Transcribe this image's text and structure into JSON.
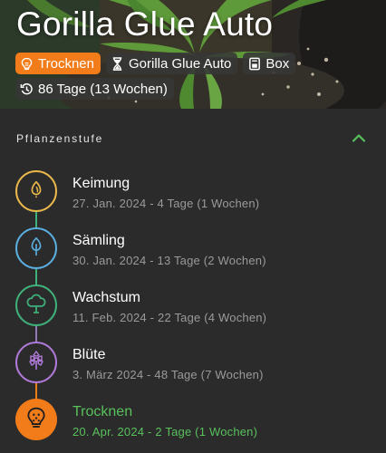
{
  "plant": {
    "title": "Gorilla Glue Auto",
    "chips": [
      {
        "icon": "trocknen-icon",
        "label": "Trocknen",
        "accent": "#f27c1a"
      },
      {
        "icon": "hourglass-icon",
        "label": "Gorilla Glue Auto"
      },
      {
        "icon": "box-icon",
        "label": "Box"
      }
    ],
    "age": {
      "icon": "history-icon",
      "label": "86 Tage (13 Wochen)"
    }
  },
  "panel": {
    "title": "Pflanzenstufe",
    "collapse_icon": "chevron-up-icon",
    "accent": "#58c05c"
  },
  "stages": [
    {
      "name": "Keimung",
      "detail": "27. Jan. 2024 - 4 Tage (1 Wochen)",
      "icon": "seed-icon",
      "color": "#e8b84a"
    },
    {
      "name": "Sämling",
      "detail": "30. Jan. 2024 - 13 Tage (2 Wochen)",
      "icon": "seedling-icon",
      "color": "#5aaee0"
    },
    {
      "name": "Wachstum",
      "detail": "11. Feb. 2024 - 22 Tage (4 Wochen)",
      "icon": "tree-icon",
      "color": "#3fb079"
    },
    {
      "name": "Blüte",
      "detail": "3. März 2024 - 48 Tage (7 Wochen)",
      "icon": "flower-icon",
      "color": "#b07ad8"
    },
    {
      "name": "Trocknen",
      "detail": "20. Apr. 2024 - 2 Tage (1 Wochen)",
      "icon": "trocknen-icon",
      "color": "#f27c1a",
      "active": true
    }
  ]
}
